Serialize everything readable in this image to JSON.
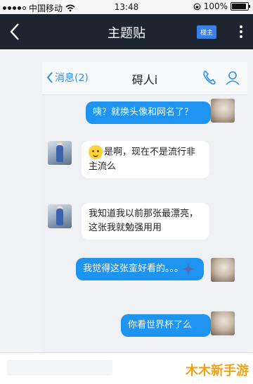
{
  "status_bar": {
    "carrier": "中国移动",
    "time": "13:48",
    "battery": "100%",
    "battery_level": 1.0
  },
  "top_nav": {
    "title": "主题贴",
    "badge": "楼主",
    "icons": [
      "chevron-left-icon",
      "more-vertical-icon"
    ]
  },
  "chat": {
    "back_label": "消息(2)",
    "contact_name": "碍人i",
    "icons": [
      "phone-icon",
      "profile-icon"
    ],
    "messages": [
      {
        "side": "out",
        "text": "咦？就换头像和网名了？"
      },
      {
        "side": "in",
        "text": "是啊，现在不是流行非主流么"
      },
      {
        "side": "in",
        "text": "我知道我以前那张最漂亮，这张我就勉强用用"
      },
      {
        "side": "out",
        "text": "我觉得这张蛮好看的。。。"
      },
      {
        "side": "out",
        "text": "你看世界杯了么"
      }
    ]
  },
  "watermark": "木木新手游",
  "colors": {
    "nav_bg": "#1d2530",
    "accent_blue": "#1f93f0",
    "badge_blue": "#3a80e5",
    "watermark": "#f0a21a"
  }
}
